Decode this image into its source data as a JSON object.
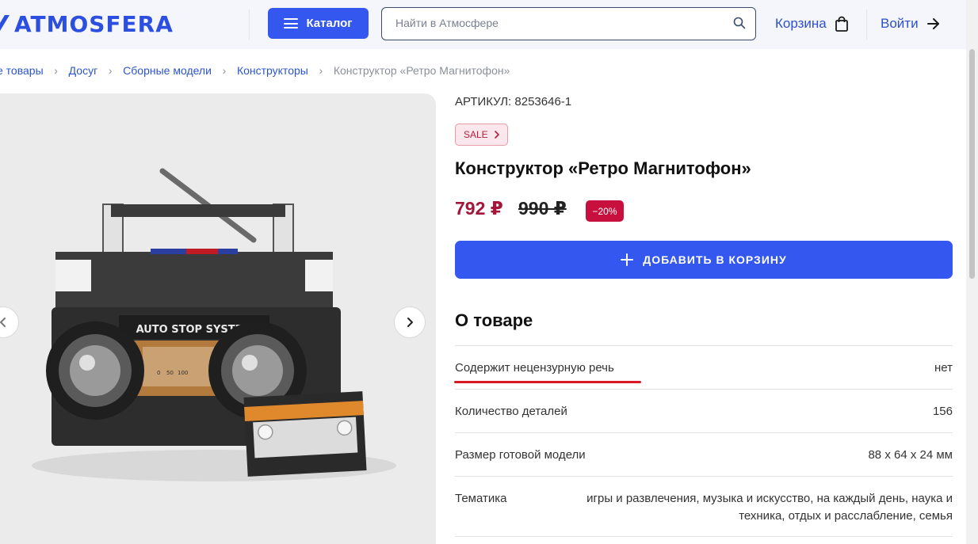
{
  "header": {
    "logo_text": "ATMOSFERA",
    "catalog_label": "Каталог",
    "search_placeholder": "Найти в Атмосфере",
    "cart_label": "Корзина",
    "login_label": "Войти"
  },
  "breadcrumbs": [
    {
      "label": "е товары"
    },
    {
      "label": "Досуг"
    },
    {
      "label": "Сборные модели"
    },
    {
      "label": "Конструкторы"
    },
    {
      "label": "Конструктор «Ретро Магнитофон»"
    }
  ],
  "product": {
    "sku": "АРТИКУЛ: 8253646-1",
    "sale_badge": "SALE",
    "title": "Конструктор «Ретро Магнитофон»",
    "price": "792 ₽",
    "old_price": "990 ₽",
    "discount": "−20%",
    "add_to_cart_label": "ДОБАВИТЬ В КОРЗИНУ",
    "image_text": "AUTO STOP SYSTEM",
    "image_scale": [
      "0",
      "50",
      "100"
    ]
  },
  "about": {
    "title": "О товаре",
    "specs": [
      {
        "label": "Содержит нецензурную речь",
        "value": "нет"
      },
      {
        "label": "Количество деталей",
        "value": "156"
      },
      {
        "label": "Размер готовой модели",
        "value": "88 x 64 x 24 мм"
      },
      {
        "label": "Тематика",
        "value_line1": "игры и развлечения, музыка и искусство, на каждый день, наука и",
        "value_line2": "техника, отдых и расслабление, семья"
      }
    ]
  },
  "colors": {
    "accent": "#3457f0",
    "price": "#a4163a",
    "discount": "#c8103e",
    "highlight": "#d91a26"
  }
}
